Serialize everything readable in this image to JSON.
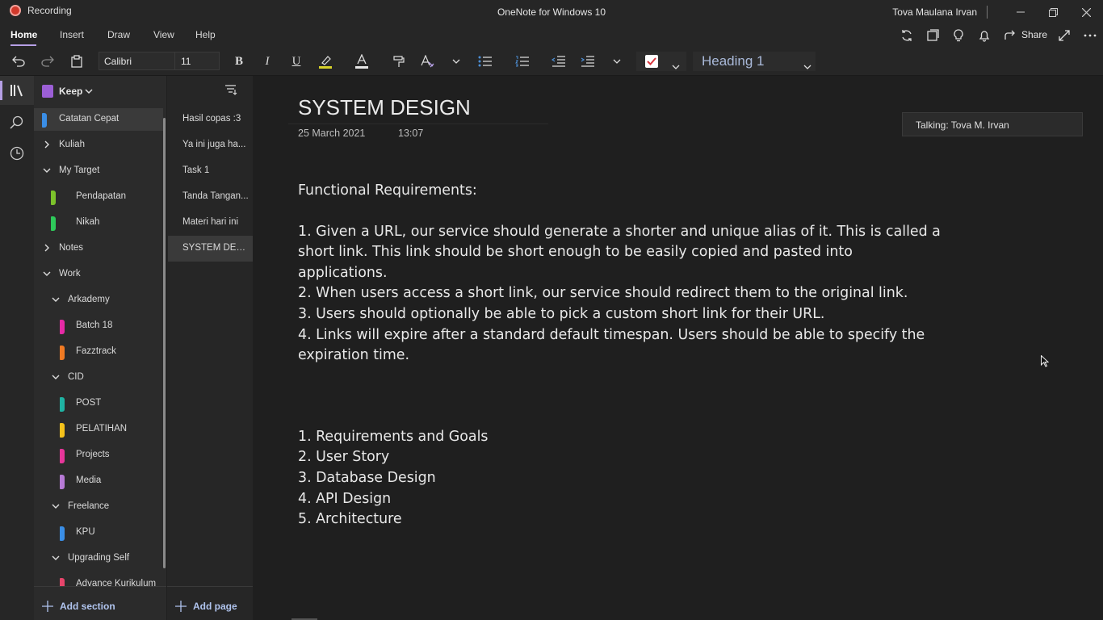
{
  "titlebar": {
    "recording_label": "Recording",
    "app_title": "OneNote for Windows 10",
    "user_name": "Tova Maulana Irvan"
  },
  "ribbon": {
    "tabs": [
      "Home",
      "Insert",
      "Draw",
      "View",
      "Help"
    ],
    "active_tab": "Home",
    "share_label": "Share"
  },
  "toolbar": {
    "font_name": "Calibri",
    "font_size": "11",
    "style_name": "Heading 1"
  },
  "notebook": {
    "name": "Keep",
    "sections": [
      {
        "label": "Catatan Cepat",
        "color": "#3a8ee6",
        "selected": true
      },
      {
        "label": "Kuliah",
        "group": true
      },
      {
        "label": "My Target",
        "group": true
      },
      {
        "label": "Pendapatan",
        "color": "#7cc22b"
      },
      {
        "label": "Nikah",
        "color": "#2ec95a"
      },
      {
        "label": "Notes",
        "group": true
      },
      {
        "label": "Work",
        "group": true
      },
      {
        "label": "Arkademy",
        "group": true
      },
      {
        "label": "Batch 18",
        "color": "#e62aa6"
      },
      {
        "label": "Fazztrack",
        "color": "#f07a23"
      },
      {
        "label": "CID",
        "group": true
      },
      {
        "label": "POST",
        "color": "#1fb3a3"
      },
      {
        "label": "PELATIHAN",
        "color": "#f5c21b"
      },
      {
        "label": "Projects",
        "color": "#e6369a"
      },
      {
        "label": "Media",
        "color": "#b77ad6"
      },
      {
        "label": "Freelance",
        "group": true
      },
      {
        "label": "KPU",
        "color": "#3a8ee6"
      },
      {
        "label": "Upgrading Self",
        "group": true
      },
      {
        "label": "Advance Kurikulum",
        "color": "#e6456b"
      }
    ],
    "add_section_label": "Add section"
  },
  "pages": {
    "items": [
      "Hasil copas :3",
      "Ya ini juga ha...",
      "Task 1",
      "Tanda Tangan...",
      "Materi hari ini",
      "SYSTEM DESI..."
    ],
    "selected_index": 5,
    "add_page_label": "Add page"
  },
  "note": {
    "title": "SYSTEM DESIGN",
    "date": "25 March 2021",
    "time": "13:07",
    "heading": "Functional Requirements:",
    "req1": "1. Given a URL, our service should generate a shorter and unique alias of it. This is called a short link. This link should be short enough to be easily copied and pasted into applications.",
    "req2": "2. When users access a short link, our service should redirect them to the original link.",
    "req3": "3. Users should optionally be able to pick a custom short link for their URL.",
    "req4": "4. Links will expire after a standard default timespan. Users should be able to specify the expiration time.",
    "outline": [
      "1. Requirements and Goals",
      "2. User Story",
      "3. Database Design",
      "4. API Design",
      "5. Architecture"
    ]
  },
  "talking_tooltip": "Talking: Tova M. Irvan",
  "colors": {
    "accent": "#b6a0e6",
    "notebook_icon": "#9c5fd6",
    "link_text": "#b0c4ee"
  }
}
